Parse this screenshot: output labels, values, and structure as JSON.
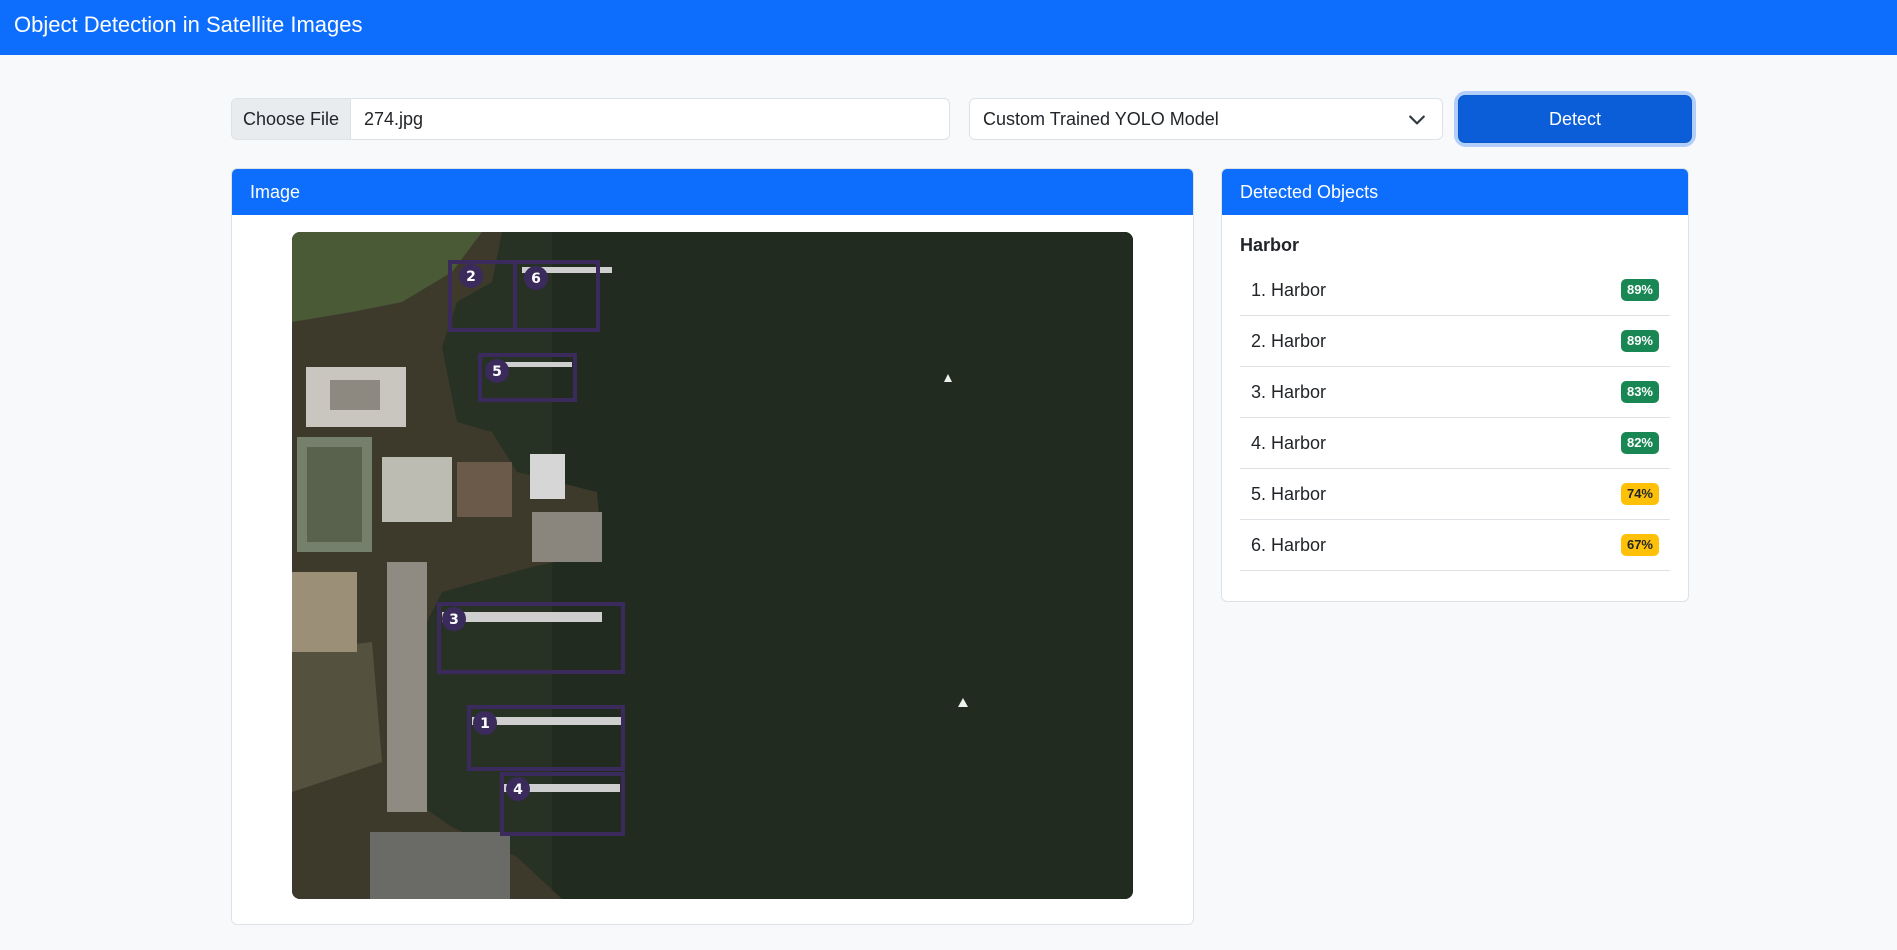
{
  "app": {
    "title": "Object Detection in Satellite Images"
  },
  "controls": {
    "choose_file_label": "Choose File",
    "file_name": "274.jpg",
    "model_selected": "Custom Trained YOLO Model",
    "detect_label": "Detect"
  },
  "image_panel": {
    "title": "Image"
  },
  "objects_panel": {
    "title": "Detected Objects",
    "group": "Harbor",
    "items": [
      {
        "label": "1. Harbor",
        "confidence": "89%",
        "status_color": "#198754"
      },
      {
        "label": "2. Harbor",
        "confidence": "89%",
        "status_color": "#198754"
      },
      {
        "label": "3. Harbor",
        "confidence": "83%",
        "status_color": "#198754"
      },
      {
        "label": "4. Harbor",
        "confidence": "82%",
        "status_color": "#198754"
      },
      {
        "label": "5. Harbor",
        "confidence": "74%",
        "status_color": "#ffc107"
      },
      {
        "label": "6. Harbor",
        "confidence": "67%",
        "status_color": "#ffc107"
      }
    ]
  },
  "detections": [
    {
      "id": "1"
    },
    {
      "id": "2"
    },
    {
      "id": "3"
    },
    {
      "id": "4"
    },
    {
      "id": "5"
    },
    {
      "id": "6"
    }
  ],
  "colors": {
    "accent": "#0d6efd",
    "box": "#3b2a5c",
    "high_confidence": "#198754",
    "mid_confidence": "#ffc107"
  }
}
